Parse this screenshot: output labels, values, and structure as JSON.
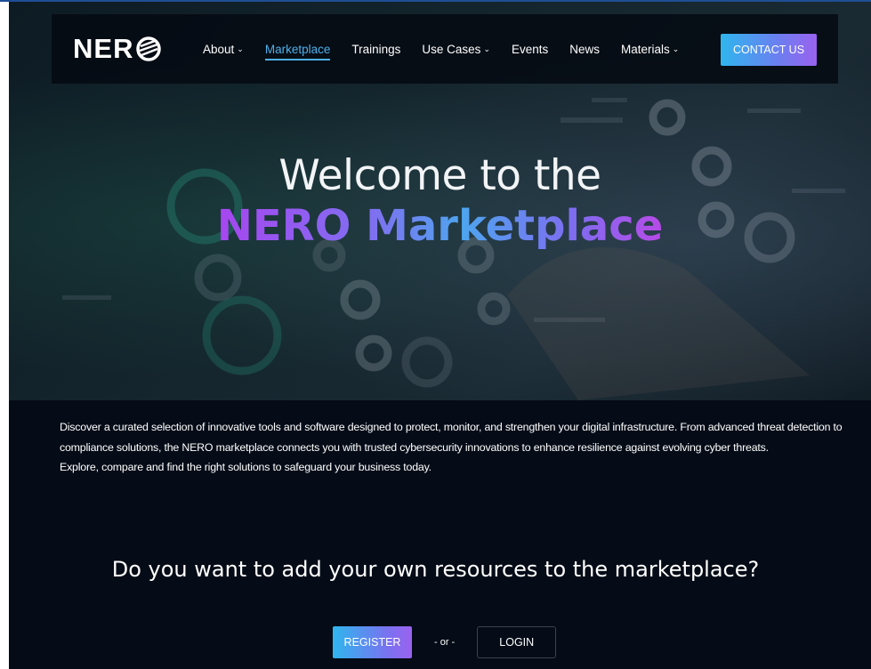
{
  "nav": {
    "logo": "NER",
    "items": [
      {
        "label": "About",
        "dropdown": true,
        "active": false
      },
      {
        "label": "Marketplace",
        "dropdown": false,
        "active": true
      },
      {
        "label": "Trainings",
        "dropdown": false,
        "active": false
      },
      {
        "label": "Use Cases",
        "dropdown": true,
        "active": false
      },
      {
        "label": "Events",
        "dropdown": false,
        "active": false
      },
      {
        "label": "News",
        "dropdown": false,
        "active": false
      },
      {
        "label": "Materials",
        "dropdown": true,
        "active": false
      }
    ],
    "contact_label": "CONTACT US"
  },
  "hero": {
    "title": "Welcome to the",
    "subtitle": "NERO Marketplace"
  },
  "intro": {
    "paragraph": "Discover a curated selection of innovative tools and software designed to protect, monitor, and strengthen your digital infrastructure. From advanced threat detection to compliance solutions, the NERO marketplace connects you with trusted cybersecurity innovations to enhance resilience against evolving cyber threats.",
    "line2": "Explore, compare and find the right solutions to safeguard your business today."
  },
  "cta": {
    "heading": "Do you want to add your own resources to the marketplace?",
    "register_label": "REGISTER",
    "or_label": "- or -",
    "login_label": "LOGIN"
  },
  "colors": {
    "background": "#050c17",
    "accent_blue": "#4fb0ea",
    "gradient_start": "#2fb6ee",
    "gradient_end": "#9a62ef"
  }
}
